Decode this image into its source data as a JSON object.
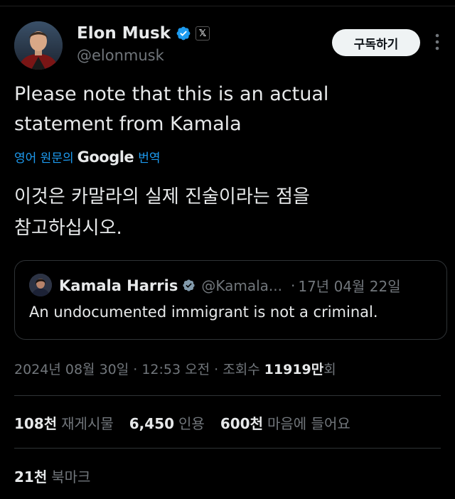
{
  "colors": {
    "background": "#000000",
    "text": "#e7e9ea",
    "muted": "#71767b",
    "link": "#1d9bf0",
    "verified": "#1d9bf0",
    "border": "#2f3336"
  },
  "author": {
    "name": "Elon Musk",
    "handle": "@elonmusk",
    "badge_icon": "x-logo-icon",
    "verified_icon": "verified-badge-icon"
  },
  "subscribe_label": "구독하기",
  "more_icon": "more-vertical-icon",
  "tweet": {
    "text_line1": "Please note that this is an actual",
    "text_line2": "statement from Kamala",
    "translate_prefix": "영어 원문의",
    "translate_google": "Google",
    "translate_suffix": "번역",
    "translated_line1": "이것은 카말라의 실제 진술이라는 점을",
    "translated_line2": "참고하십시오."
  },
  "quote": {
    "name": "Kamala Harris",
    "handle": "@Kamala...",
    "dot": "·",
    "date": "17년 04월 22일",
    "text": "An undocumented immigrant is not a criminal."
  },
  "meta": {
    "timestamp": "2024년 08월 30일 · 12:53 오전 · 조회수",
    "views_count": "11919만",
    "views_suffix": "회"
  },
  "stats": {
    "reposts_count": "108천",
    "reposts_label": "재게시물",
    "quotes_count": "6,450",
    "quotes_label": "인용",
    "likes_count": "600천",
    "likes_label": "마음에 들어요",
    "bookmarks_count": "21천",
    "bookmarks_label": "북마크"
  }
}
